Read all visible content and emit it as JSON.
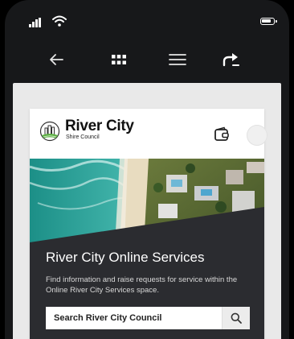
{
  "status_bar": {
    "signal_icon": "cellular-signal-icon",
    "wifi_icon": "wifi-icon",
    "battery_icon": "battery-icon"
  },
  "toolbar": {
    "back_icon": "arrow-left-icon",
    "apps_icon": "grid-icon",
    "menu_icon": "hamburger-menu-icon",
    "share_icon": "share-arrow-icon"
  },
  "header": {
    "logo_icon": "river-city-logo",
    "brand_name": "River City",
    "brand_sub": "Shire Council",
    "wallet_icon": "wallet-icon",
    "avatar_icon": "avatar"
  },
  "hero": {
    "title": "River City Online Services",
    "description": "Find information and raise requests for service within the Online River City Services space."
  },
  "search": {
    "placeholder": "Search River City Council",
    "button_icon": "search-icon"
  },
  "colors": {
    "phone_bg": "#17181a",
    "content_bg": "#e9e9e9",
    "hero_bg": "#2b2c30",
    "logo_green": "#5fb246"
  }
}
